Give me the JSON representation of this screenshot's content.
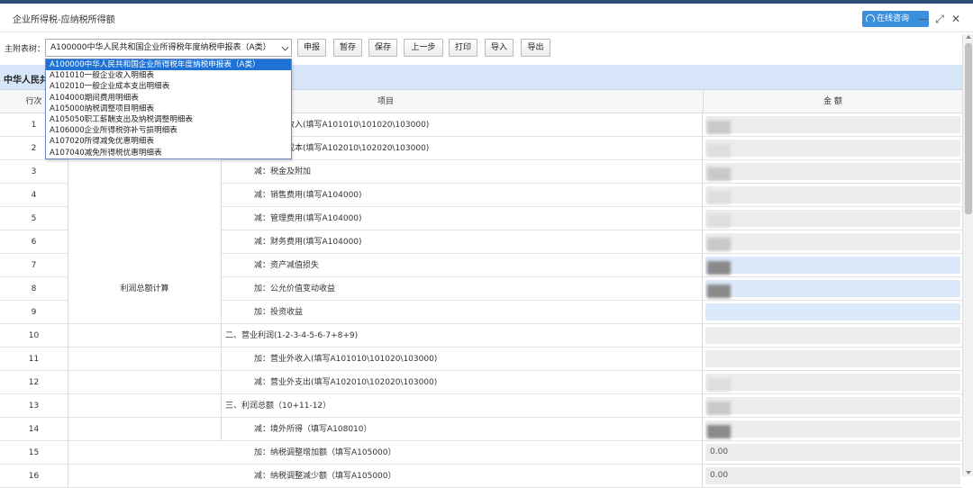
{
  "window": {
    "title": "企业所得税-应纳税所得额",
    "consult_label": "在线咨询",
    "minimize": "—",
    "restore": "⤢",
    "close": "✕"
  },
  "toolbar": {
    "label": "主附表树：",
    "selected": "A100000中华人民共和国企业所得税年度纳税申报表（A类）",
    "buttons": [
      "申报",
      "暂存",
      "保存",
      "上一步",
      "打印",
      "导入",
      "导出"
    ]
  },
  "dropdown": {
    "options": [
      "A100000中华人民共和国企业所得税年度纳税申报表（A类）",
      "A101010一般企业收入明细表",
      "A102010一般企业成本支出明细表",
      "A104000期间费用明细表",
      "A105000纳税调整项目明细表",
      "A105050职工薪酬支出及纳税调整明细表",
      "A106000企业所得税弥补亏损明细表",
      "A107020所得减免优惠明细表",
      "A107040减免所得税优惠明细表"
    ]
  },
  "form": {
    "heading": "中华人民共和",
    "col_no": "行次",
    "col_item": "项目",
    "col_amount": "金 额",
    "group_label": "利润总额计算",
    "rows": [
      {
        "no": "1",
        "item": "一、营业收入(填写A101010\\101020\\103000)"
      },
      {
        "no": "2",
        "item": "减：营业成本(填写A102010\\102020\\103000)"
      },
      {
        "no": "3",
        "item": "减：税金及附加"
      },
      {
        "no": "4",
        "item": "减：销售费用(填写A104000)"
      },
      {
        "no": "5",
        "item": "减：管理费用(填写A104000)"
      },
      {
        "no": "6",
        "item": "减：财务费用(填写A104000)"
      },
      {
        "no": "7",
        "item": "减：资产减值损失"
      },
      {
        "no": "8",
        "item": "加：公允价值变动收益"
      },
      {
        "no": "9",
        "item": "加：投资收益"
      },
      {
        "no": "10",
        "item": "二、营业利润(1-2-3-4-5-6-7+8+9)"
      },
      {
        "no": "11",
        "item": "加：营业外收入(填写A101010\\101020\\103000)"
      },
      {
        "no": "12",
        "item": "减：营业外支出(填写A102010\\102020\\103000)"
      },
      {
        "no": "13",
        "item": "三、利润总额（10+11-12）"
      },
      {
        "no": "14",
        "item": "减：境外所得（填写A108010）"
      },
      {
        "no": "15",
        "item": "加：纳税调整增加额（填写A105000）",
        "amount": "0.00"
      },
      {
        "no": "16",
        "item": "减：纳税调整减少额（填写A105000）",
        "amount": "0.00"
      }
    ]
  }
}
